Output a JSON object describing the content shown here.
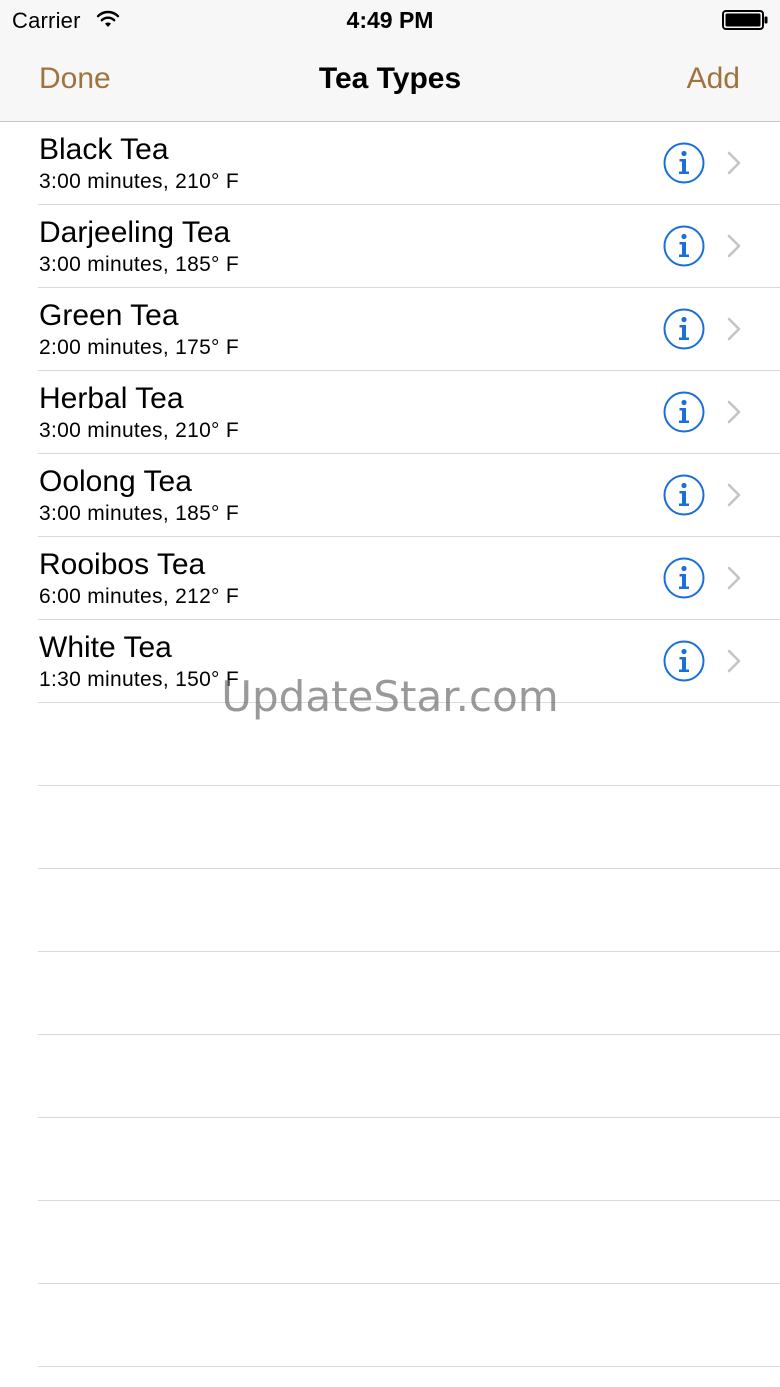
{
  "status": {
    "carrier": "Carrier",
    "time": "4:49 PM",
    "wifi_icon": "wifi-icon",
    "battery_icon": "battery-icon"
  },
  "nav": {
    "left_label": "Done",
    "title": "Tea Types",
    "right_label": "Add",
    "accent_color": "#a0723e"
  },
  "teas": [
    {
      "name": "Black Tea",
      "detail": "3:00 minutes, 210° F"
    },
    {
      "name": "Darjeeling Tea",
      "detail": "3:00 minutes, 185° F"
    },
    {
      "name": "Green Tea",
      "detail": "2:00 minutes, 175° F"
    },
    {
      "name": "Herbal Tea",
      "detail": "3:00 minutes, 210° F"
    },
    {
      "name": "Oolong Tea",
      "detail": "3:00 minutes, 185° F"
    },
    {
      "name": "Rooibos Tea",
      "detail": "6:00 minutes, 212° F"
    },
    {
      "name": "White Tea",
      "detail": "1:30 minutes, 150° F"
    }
  ],
  "row_icons": {
    "info": "info-circle-icon",
    "disclosure": "chevron-right-icon",
    "info_color": "#1a6fd8"
  },
  "watermark": "UpdateStar.com"
}
